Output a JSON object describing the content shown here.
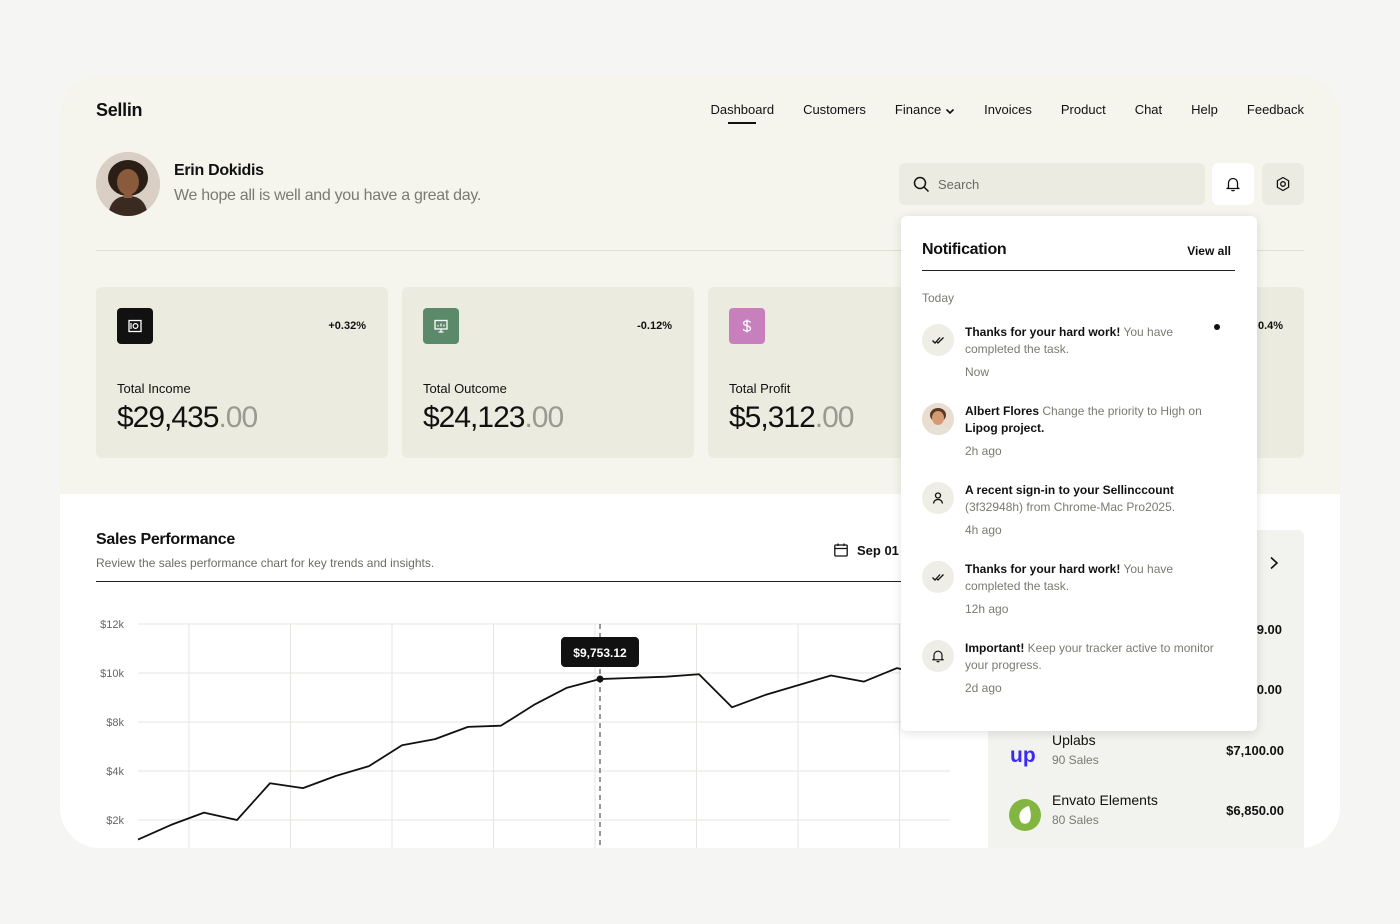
{
  "app": {
    "name": "Sellin"
  },
  "nav": {
    "items": [
      {
        "label": "Dashboard",
        "active": true
      },
      {
        "label": "Customers"
      },
      {
        "label": "Finance",
        "has_dropdown": true
      },
      {
        "label": "Invoices"
      },
      {
        "label": "Product"
      },
      {
        "label": "Chat"
      },
      {
        "label": "Help"
      },
      {
        "label": "Feedback"
      }
    ]
  },
  "user": {
    "name": "Erin Dokidis",
    "greeting": "We hope all is well and you have a great day."
  },
  "search": {
    "placeholder": "Search"
  },
  "stats": [
    {
      "label": "Total Income",
      "change": "+0.32%",
      "whole": "$29,435",
      "cents": ".00",
      "icon": "safe-icon",
      "icon_color": "#111111"
    },
    {
      "label": "Total Outcome",
      "change": "-0.12%",
      "whole": "$24,123",
      "cents": ".00",
      "icon": "presentation-icon",
      "icon_color": "#5b8a6a"
    },
    {
      "label": "Total Profit",
      "change": "",
      "whole": "$5,312",
      "cents": ".00",
      "icon": "dollar-icon",
      "icon_color": "#c77fbd"
    },
    {
      "change_partial": "0.4%"
    }
  ],
  "sales": {
    "title": "Sales Performance",
    "subtitle": "Review the sales performance chart for key trends and insights.",
    "date_partial": "Sep 01 -"
  },
  "chart_data": {
    "type": "line",
    "title": "",
    "xlabel": "",
    "ylabel": "",
    "y_tick_labels": [
      "$12k",
      "$10k",
      "$8k",
      "$4k",
      "$2k"
    ],
    "y_tick_values": [
      12000,
      10000,
      8000,
      4000,
      2000
    ],
    "note": "",
    "tooltip": "$9,753.12",
    "values": [
      1200,
      1800,
      2300,
      2000,
      3500,
      3300,
      3800,
      4400,
      6100,
      6600,
      7600,
      7700,
      8700,
      9400,
      9753.12,
      9800,
      9850,
      9950,
      8600,
      9100,
      9500,
      9900,
      9650,
      10200,
      9900
    ],
    "grid": true
  },
  "right_panel": {
    "partial_amounts": [
      "9.00",
      "0.00"
    ],
    "rows": [
      {
        "name": "Uplabs",
        "sales": "90 Sales",
        "amount": "$7,100.00",
        "logo": "uplabs-logo-icon"
      },
      {
        "name": "Envato Elements",
        "sales": "80 Sales",
        "amount": "$6,850.00",
        "logo": "envato-logo-icon"
      }
    ]
  },
  "notifications": {
    "title": "Notification",
    "view_all": "View all",
    "section": "Today",
    "items": [
      {
        "bold": "Thanks for your hard work!",
        "rest": " You have completed the task.",
        "time": "Now",
        "icon": "double-check-icon",
        "unread": true
      },
      {
        "bold": "Albert Flores",
        "rest": " Change the priority to High on ",
        "bold2": "Lipog project.",
        "time": "2h ago",
        "icon": "avatar"
      },
      {
        "bold": "A recent sign-in to your Sellinccount",
        "rest": " (3f32948h) from Chrome-Mac Pro2025.",
        "time": "4h ago",
        "icon": "user-icon"
      },
      {
        "bold": "Thanks for your hard work!",
        "rest": " You have completed the task.",
        "time": "12h ago",
        "icon": "double-check-icon"
      },
      {
        "bold": "Important!",
        "rest": " Keep your tracker active to monitor your progress.",
        "time": "2d ago",
        "icon": "bell-icon"
      }
    ]
  }
}
